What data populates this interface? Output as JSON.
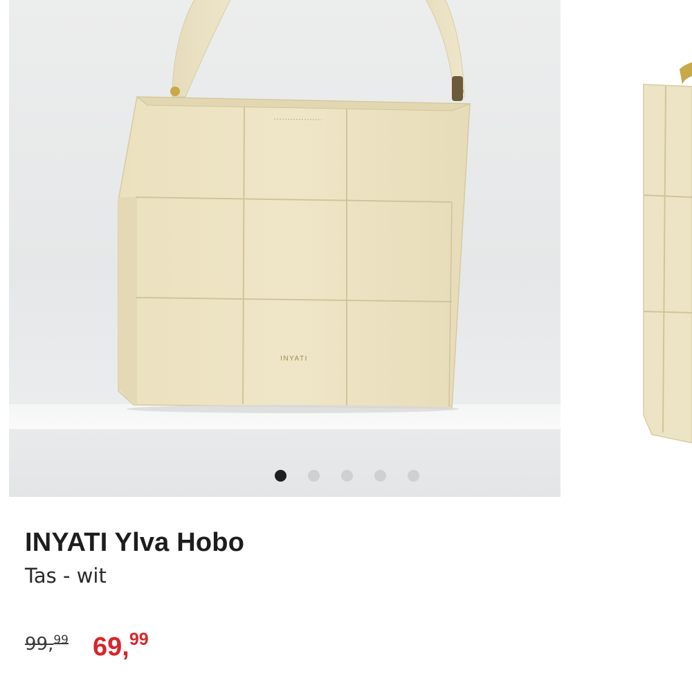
{
  "product": {
    "brand_name": "INYATI Ylva Hobo",
    "subtitle": "Tas - wit",
    "bag_logo_text": "INYATI"
  },
  "price": {
    "old_main": "99,",
    "old_cents": "99",
    "new_main": "69,",
    "new_cents": "99"
  },
  "carousel": {
    "total_images": 5,
    "active_index": 1
  },
  "colors": {
    "sale_price": "#d7262b",
    "bag": "#ede4c5",
    "active_dot": "#1f1f1f",
    "inactive_dot": "#cfd0d1"
  }
}
